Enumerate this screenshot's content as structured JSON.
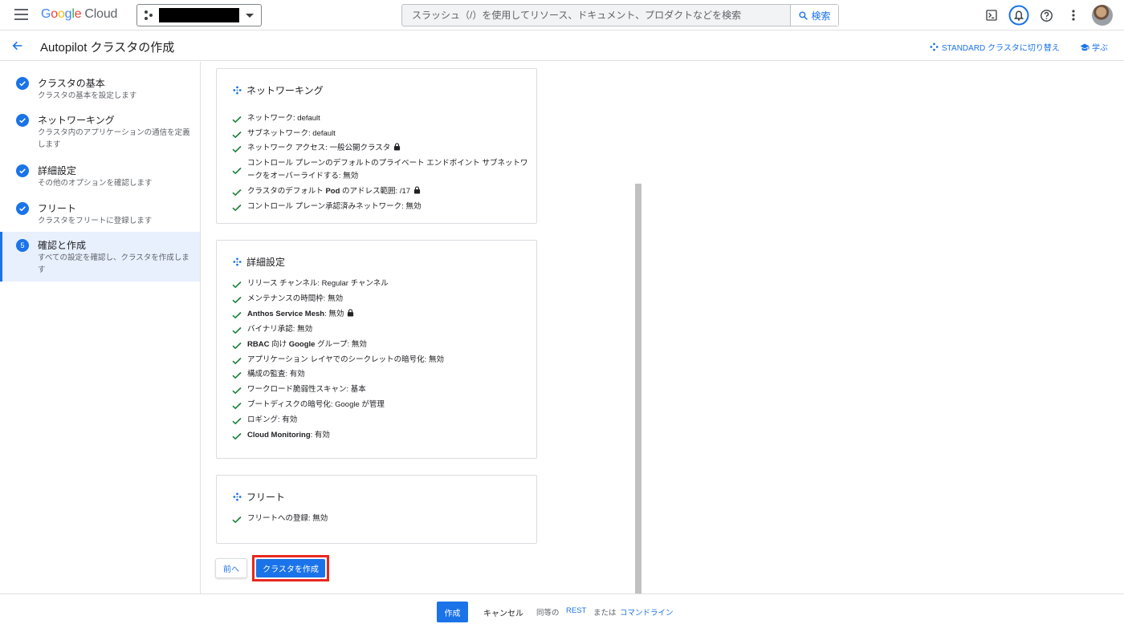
{
  "app": {
    "logo_google": [
      "G",
      "o",
      "o",
      "g",
      "l",
      "e"
    ],
    "logo_cloud": "Cloud",
    "search_placeholder": "スラッシュ（/）を使用してリソース、ドキュメント、プロダクトなどを検索",
    "search_button": "検索",
    "icons": [
      "terminal-icon",
      "bell-icon",
      "help-icon",
      "more-vert-icon"
    ],
    "accent": "#1a73e8"
  },
  "header": {
    "title": "Autopilot クラスタの作成",
    "standard_link": "STANDARD クラスタに切り替え",
    "learn_link": "学ぶ"
  },
  "steps": [
    {
      "title": "クラスタの基本",
      "desc": "クラスタの基本を設定します",
      "state": "done"
    },
    {
      "title": "ネットワーキング",
      "desc": "クラスタ内のアプリケーションの通信を定義します",
      "state": "done"
    },
    {
      "title": "詳細設定",
      "desc": "その他のオプションを確認します",
      "state": "done"
    },
    {
      "title": "フリート",
      "desc": "クラスタをフリートに登録します",
      "state": "done"
    },
    {
      "title": "確認と作成",
      "desc": "すべての設定を確認し、クラスタを作成します",
      "state": "active",
      "number": "5"
    }
  ],
  "sections": {
    "networking": {
      "title": "ネットワーキング",
      "items": [
        {
          "label": "ネットワーク: ",
          "value": "default"
        },
        {
          "label": "サブネットワーク: ",
          "value": "default"
        },
        {
          "label": "ネットワーク アクセス: ",
          "value": "一般公開クラスタ",
          "lock": true
        },
        {
          "label": "コントロール プレーンのデフォルトのプライベート エンドポイント サブネットワークをオーバーライドする: ",
          "value": "無効"
        },
        {
          "pre": "クラスタのデフォルト ",
          "bold": "Pod",
          "label": " のアドレス範囲: ",
          "value": "/17",
          "lock": true
        },
        {
          "label": "コントロール プレーン承認済みネットワーク: ",
          "value": "無効"
        }
      ]
    },
    "advanced": {
      "title": "詳細設定",
      "items": [
        {
          "label": "リリース チャンネル: ",
          "value": "Regular チャンネル"
        },
        {
          "label": "メンテナンスの時間枠: ",
          "value": "無効"
        },
        {
          "bold": "Anthos Service Mesh",
          "label": ": ",
          "value": "無効",
          "lock": true
        },
        {
          "label": "バイナリ承認: ",
          "value": "無効"
        },
        {
          "bold": "RBAC",
          "mid": " 向け ",
          "bold2": "Google",
          "label": " グループ: ",
          "value": "無効"
        },
        {
          "label": "アプリケーション レイヤでのシークレットの暗号化: ",
          "value": "無効"
        },
        {
          "label": "構成の監査: ",
          "value": "有効"
        },
        {
          "label": "ワークロード脆弱性スキャン: ",
          "value": "基本"
        },
        {
          "label": "ブートディスクの暗号化: ",
          "value": "Google が管理"
        },
        {
          "label": "ロギング: ",
          "value": "有効"
        },
        {
          "bold": "Cloud Monitoring",
          "label": ": ",
          "value": "有効"
        }
      ]
    },
    "fleet": {
      "title": "フリート",
      "items": [
        {
          "label": "フリートへの登録: ",
          "value": "無効"
        }
      ]
    }
  },
  "actions": {
    "prev": "前へ",
    "create_cluster": "クラスタを作成"
  },
  "footer": {
    "create": "作成",
    "cancel": "キャンセル",
    "equivalent": "同等の",
    "rest": "REST",
    "or": "または",
    "command_line": "コマンドライン"
  }
}
